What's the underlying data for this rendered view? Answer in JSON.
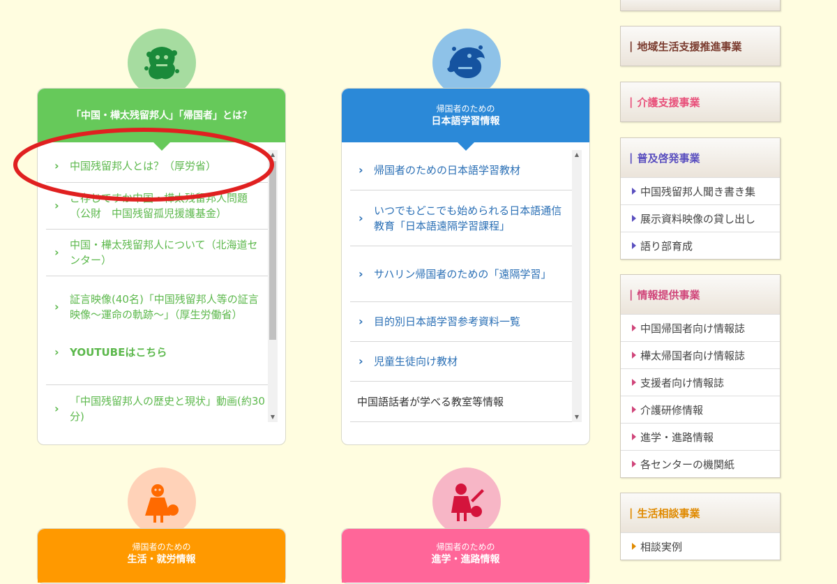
{
  "colors": {
    "green": "#66c95a",
    "green_light": "#a6dca0",
    "blue": "#2b89d8",
    "blue_light": "#8ec2e8",
    "orange": "#ff9900",
    "orange_light": "#ffd2b8",
    "pink": "#ff6699",
    "pink_light": "#f7b6c6",
    "green_text": "#5cb84c",
    "blue_text": "#2a6fb5",
    "annotation_red": "#e02020"
  },
  "card1": {
    "emblem_icon": "lion-papercut-icon",
    "title": "「中国・樺太残留邦人」「帰国者」とは？",
    "items": [
      {
        "text": "中国残留邦人とは？（厚労省）"
      },
      {
        "text": "ご存じですか中国・樺太残留邦人問題（公財　中国残留孤児援護基金）"
      },
      {
        "text": "中国・樺太残留邦人について（北海道センター）"
      },
      {
        "text": "証言映像(40名)「中国残留邦人等の証言映像～運命の軌跡～」（厚生労働省）"
      },
      {
        "text": "YOUTUBEはこちら"
      },
      {
        "text": "「中国残留邦人の歴史と現状」動画(約30分)"
      }
    ]
  },
  "card2": {
    "emblem_icon": "dragon-papercut-icon",
    "subtitle": "帰国者のための",
    "title": "日本語学習情報",
    "items": [
      {
        "text": "帰国者のための日本語学習教材"
      },
      {
        "text": "いつでもどこでも始められる日本語通信教育「日本語遠隔学習課程」"
      },
      {
        "text": "サハリン帰国者のための「遠隔学習」"
      },
      {
        "text": "目的別日本語学習参考資料一覧"
      },
      {
        "text": "児童生徒向け教材"
      },
      {
        "text": "中国語話者が学べる教室等情報"
      }
    ]
  },
  "card3": {
    "emblem_icon": "girl-papercut-icon",
    "subtitle": "帰国者のための",
    "title": "生活・就労情報"
  },
  "card4": {
    "emblem_icon": "child-papercut-icon",
    "subtitle": "帰国者のための",
    "title": "進学・進路情報"
  },
  "sidebar": {
    "sections": [
      {
        "title": "地域生活支援推進事業",
        "color": "#7a3b2e",
        "items": []
      },
      {
        "title": "介護支援事業",
        "color": "#e8507a",
        "items": []
      },
      {
        "title": "普及啓発事業",
        "color": "#5a4fbf",
        "items": [
          "中国残留邦人聞き書き集",
          "展示資料映像の貸し出し",
          "語り部育成"
        ]
      },
      {
        "title": "情報提供事業",
        "color": "#d0457a",
        "items": [
          "中国帰国者向け情報誌",
          "樺太帰国者向け情報誌",
          "支援者向け情報誌",
          "介護研修情報",
          "進学・進路情報",
          "各センターの機関紙"
        ]
      },
      {
        "title": "生活相談事業",
        "color": "#e08a00",
        "items": [
          "相談実例"
        ]
      }
    ]
  }
}
